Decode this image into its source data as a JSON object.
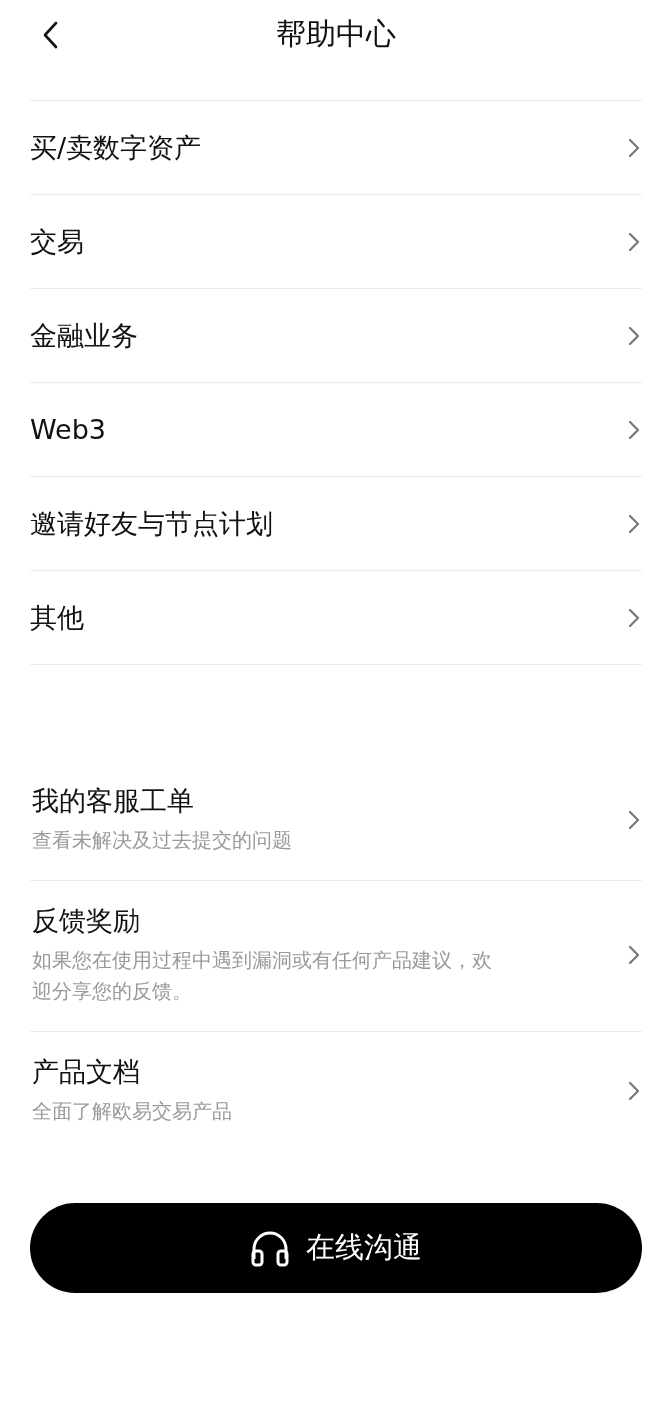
{
  "header": {
    "title": "帮助中心"
  },
  "categories": [
    {
      "label": "买/卖数字资产"
    },
    {
      "label": "交易"
    },
    {
      "label": "金融业务"
    },
    {
      "label": "Web3"
    },
    {
      "label": "邀请好友与节点计划"
    },
    {
      "label": "其他"
    }
  ],
  "services": [
    {
      "title": "我的客服工单",
      "description": "查看未解决及过去提交的问题"
    },
    {
      "title": "反馈奖励",
      "description": "如果您在使用过程中遇到漏洞或有任何产品建议，欢迎分享您的反馈。"
    },
    {
      "title": "产品文档",
      "description": "全面了解欧易交易产品"
    }
  ],
  "chat_button": {
    "label": "在线沟通"
  }
}
